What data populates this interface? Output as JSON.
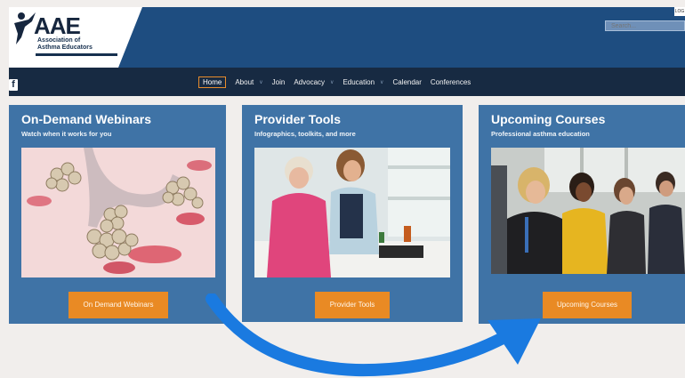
{
  "header": {
    "logo_text": "AAE",
    "logo_subtitle_line1": "Association of",
    "logo_subtitle_line2": "Asthma Educators",
    "login_label": "LOG",
    "search_placeholder": "Search..."
  },
  "nav": {
    "items": [
      {
        "label": "Home",
        "active": true,
        "has_dropdown": false
      },
      {
        "label": "About",
        "active": false,
        "has_dropdown": true
      },
      {
        "label": "Join",
        "active": false,
        "has_dropdown": false
      },
      {
        "label": "Advocacy",
        "active": false,
        "has_dropdown": true
      },
      {
        "label": "Education",
        "active": false,
        "has_dropdown": true
      },
      {
        "label": "Calendar",
        "active": false,
        "has_dropdown": false
      },
      {
        "label": "Conferences",
        "active": false,
        "has_dropdown": false
      }
    ],
    "social_icon": "facebook-icon"
  },
  "panels": [
    {
      "title": "On-Demand Webinars",
      "subtitle": "Watch when it works for you",
      "button": "On Demand Webinars",
      "image": "lung-alveoli-illustration"
    },
    {
      "title": "Provider Tools",
      "subtitle": "Infographics, toolkits, and more",
      "button": "Provider Tools",
      "image": "clinician-with-patient-photo"
    },
    {
      "title": "Upcoming Courses",
      "subtitle": "Professional asthma education",
      "button": "Upcoming Courses",
      "image": "seminar-audience-photo"
    }
  ],
  "colors": {
    "header_blue": "#1e4d80",
    "nav_dark": "#172a42",
    "panel_blue": "#3f73a6",
    "button_orange": "#e98a24",
    "arrow_blue": "#1a7ae0",
    "background": "#f1eeec"
  },
  "annotation": {
    "arrow": "curved-arrow-icon"
  }
}
